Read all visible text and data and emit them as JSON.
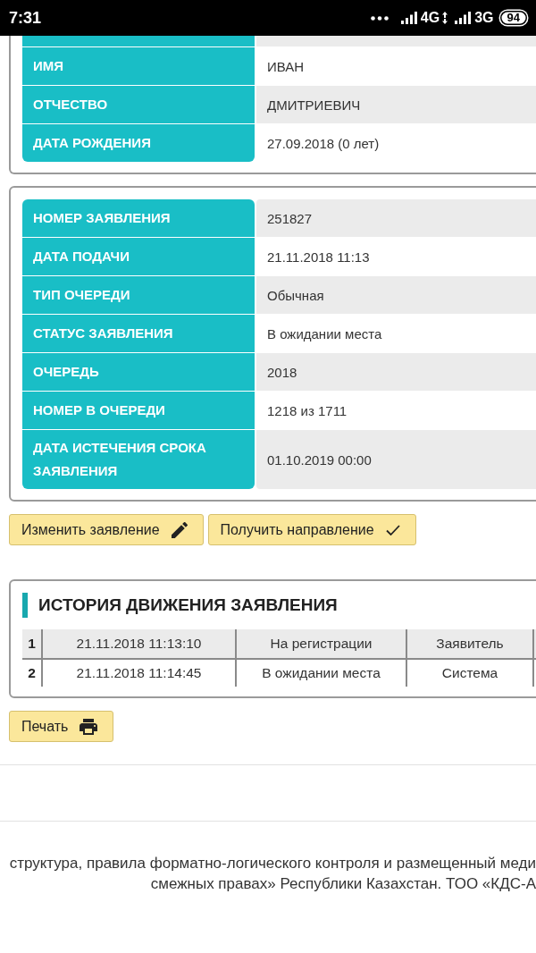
{
  "status_bar": {
    "time": "7:31",
    "networks": [
      {
        "label": "4G",
        "data_active": true
      },
      {
        "label": "3G",
        "data_active": false
      }
    ],
    "battery": "94"
  },
  "sections": [
    {
      "clipped_top": true,
      "rows": [
        {
          "label": "ИМЯ",
          "value": "ИВАН"
        },
        {
          "label": "ОТЧЕСТВО",
          "value": "ДМИТРИЕВИЧ"
        },
        {
          "label": "ДАТА РОЖДЕНИЯ",
          "value": "27.09.2018 (0 лет)"
        }
      ]
    },
    {
      "clipped_top": false,
      "rows": [
        {
          "label": "НОМЕР ЗАЯВЛЕНИЯ",
          "value": "251827"
        },
        {
          "label": "ДАТА ПОДАЧИ",
          "value": "21.11.2018 11:13"
        },
        {
          "label": "ТИП ОЧЕРЕДИ",
          "value": "Обычная"
        },
        {
          "label": "СТАТУС ЗАЯВЛЕНИЯ",
          "value": "В ожидании места"
        },
        {
          "label": "ОЧЕРЕДЬ",
          "value": "2018"
        },
        {
          "label": "НОМЕР В ОЧЕРЕДИ",
          "value": "1218 из 1711"
        },
        {
          "label": "ДАТА ИСТЕЧЕНИЯ СРОКА ЗАЯВЛЕНИЯ",
          "value": "01.10.2019 00:00"
        }
      ]
    }
  ],
  "actions": [
    {
      "label": "Изменить заявление",
      "kind": "edit"
    },
    {
      "label": "Получить направление",
      "kind": "confirm"
    }
  ],
  "history": {
    "title": "ИСТОРИЯ ДВИЖЕНИЯ ЗАЯВЛЕНИЯ",
    "rows": [
      {
        "cells": [
          "1",
          "21.11.2018 11:13:10",
          "На регистрации",
          "Заявитель"
        ]
      },
      {
        "cells": [
          "2",
          "21.11.2018 11:14:45",
          "В ожидании места",
          "Система"
        ]
      }
    ]
  },
  "print_action": {
    "label": "Печать",
    "kind": "print"
  },
  "footer": {
    "text": "структура, правила форматно-логического контроля и размещенный меди\nсмежных правах» Республики Казахстан. ТОО «КДС-А"
  }
}
